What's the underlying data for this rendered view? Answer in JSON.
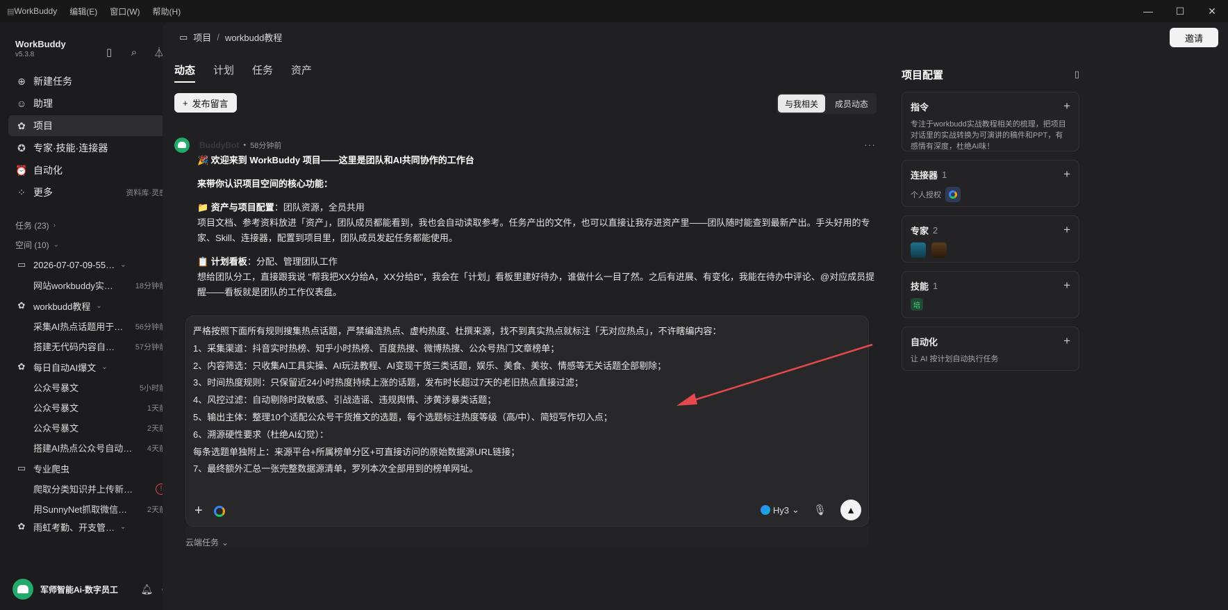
{
  "titlebar": {
    "app_name": "WorkBuddy",
    "menus": [
      "编辑(E)",
      "窗口(W)",
      "帮助(H)"
    ]
  },
  "sidebar": {
    "brand": "WorkBuddy",
    "version": "v5.3.8",
    "nav": [
      {
        "label": "新建任务",
        "icon": "plus-circle-icon"
      },
      {
        "label": "助理",
        "icon": "assistant-icon"
      },
      {
        "label": "项目",
        "icon": "project-icon",
        "active": true
      },
      {
        "label": "专家·技能·连接器",
        "icon": "expert-icon"
      },
      {
        "label": "自动化",
        "icon": "alarm-icon"
      },
      {
        "label": "更多",
        "icon": "grid-icon",
        "extra": "资料库·灵感"
      }
    ],
    "tasks_header": "任务 (23)",
    "spaces_header": "空间 (10)",
    "groups": [
      {
        "label": "2026-07-07-09-55…",
        "items": [
          {
            "name": "网站workbuddy实…",
            "time": "18分钟前"
          }
        ]
      },
      {
        "label": "workbudd教程",
        "items": [
          {
            "name": "采集AI热点话题用于…",
            "time": "56分钟前"
          },
          {
            "name": "搭建无代码内容自…",
            "time": "57分钟前"
          }
        ]
      },
      {
        "label": "每日自动AI爆文",
        "items": [
          {
            "name": "公众号暴文",
            "time": "5小时前"
          },
          {
            "name": "公众号暴文",
            "time": "1天前"
          },
          {
            "name": "公众号暴文",
            "time": "2天前"
          },
          {
            "name": "搭建AI热点公众号自动…",
            "time": "4天前"
          }
        ]
      },
      {
        "label": "专业爬虫",
        "items": [
          {
            "name": "爬取分类知识并上传新…",
            "time": ""
          },
          {
            "name": "用SunnyNet抓取微信…",
            "time": "2天前"
          }
        ]
      },
      {
        "label": "雨虹考勤、开支管…",
        "items": []
      }
    ],
    "user_name": "军师智能Ai-数字员工"
  },
  "main": {
    "breadcrumb": {
      "root": "项目",
      "current": "workbudd教程"
    },
    "invite_label": "邀请",
    "tabs": [
      "动态",
      "计划",
      "任务",
      "资产"
    ],
    "post_button": "发布留言",
    "filters": [
      "与我相关",
      "成员动态"
    ],
    "message": {
      "author": "BuddyBot",
      "time": "58分钟前",
      "title": "🎉 欢迎来到 WorkBuddy 项目——这里是团队和AI共同协作的工作台",
      "intro": "来带你认识项目空间的核心功能：",
      "sec1_title": "📁 资产与项目配置",
      "sec1_tag": "：团队资源，全员共用",
      "sec1_body": "项目文档、参考资料放进「资产」，团队成员都能看到，我也会自动读取参考。任务产出的文件，也可以直接让我存进资产里——团队随时能查到最新产出。手头好用的专家、Skill、连接器，配置到项目里，团队成员发起任务都能使用。",
      "sec2_title": "📋 计划看板",
      "sec2_tag": "：分配、管理团队工作",
      "sec2_body": "想给团队分工，直接跟我说 \"帮我把XX分给A，XX分给B\"，我会在「计划」看板里建好待办，谁做什么一目了然。之后有进展、有变化，我能在待办中评论、@对应成员提醒——看板就是团队的工作仪表盘。"
    },
    "composer": {
      "lines": [
        "严格按照下面所有规则搜集热点话题，严禁编造热点、虚构热度、杜撰来源，找不到真实热点就标注「无对应热点」，不许瞎编内容：",
        "1、采集渠道：抖音实时热榜、知乎小时热榜、百度热搜、微博热搜、公众号热门文章榜单；",
        "2、内容筛选：只收集AI工具实操、AI玩法教程、AI变现干货三类话题，娱乐、美食、美妆、情感等无关话题全部剔除；",
        "3、时间热度规则：只保留近24小时热度持续上涨的话题，发布时长超过7天的老旧热点直接过滤；",
        "4、风控过滤：自动剔除时政敏感、引战造谣、违规舆情、涉黄涉暴类话题；",
        "5、输出主体：整理10个适配公众号干货推文的选题，每个选题标注热度等级（高/中）、简短写作切入点；",
        "6、溯源硬性要求（杜绝AI幻觉）：",
        "每条选题单独附上：来源平台+所属榜单分区+可直接访问的原始数据源URL链接；",
        "7、最终额外汇总一张完整数据源清单，罗列本次全部用到的榜单网址。"
      ],
      "model": "Hy3",
      "cloud_task": "云端任务"
    }
  },
  "right_panel": {
    "title": "项目配置",
    "cards": {
      "instructions": {
        "title": "指令",
        "desc": "专注于workbudd实战教程相关的梳理，把项目对话里的实战转换为可演讲的稿件和PPT，有感情有深度，杜绝AI味！"
      },
      "connectors": {
        "title": "连接器",
        "count": "1",
        "row": "个人授权"
      },
      "experts": {
        "title": "专家",
        "count": "2"
      },
      "skills": {
        "title": "技能",
        "count": "1",
        "badge": "培"
      },
      "automation": {
        "title": "自动化",
        "desc": "让 AI 按计划自动执行任务"
      }
    }
  },
  "colors": {
    "accent_red": "#e5484d",
    "brand_green": "#23a96a"
  }
}
